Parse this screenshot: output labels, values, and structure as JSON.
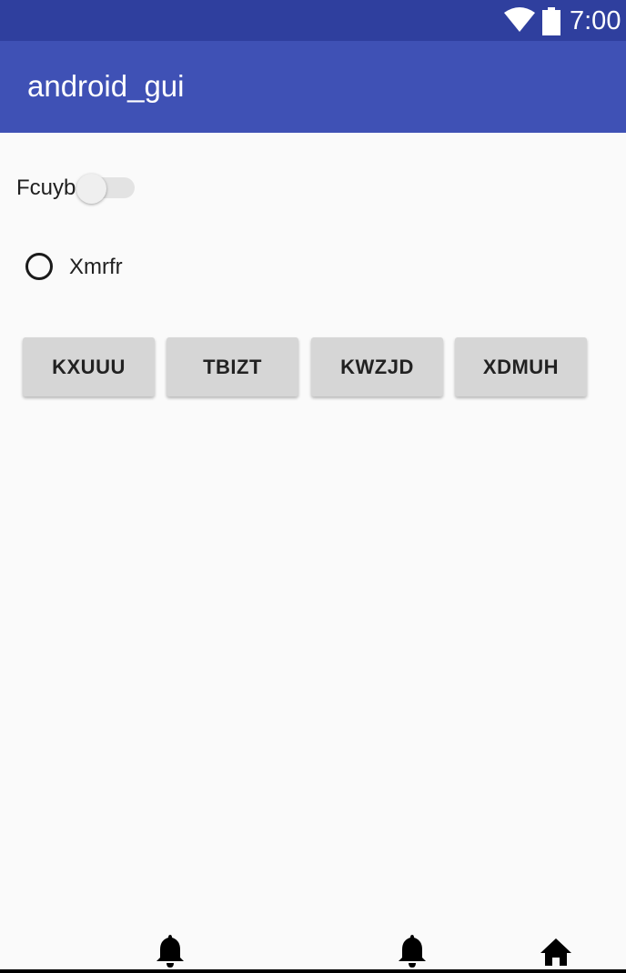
{
  "status_bar": {
    "time": "7:00",
    "icons": [
      "wifi-icon",
      "battery-icon"
    ],
    "background": "#2f3f9e"
  },
  "app_bar": {
    "title": "android_gui",
    "background": "#3f51b5"
  },
  "switch": {
    "label": "Fcuyb",
    "checked": false
  },
  "radio": {
    "label": "Xmrfr",
    "checked": false
  },
  "buttons": [
    {
      "label": "KXUUU"
    },
    {
      "label": "TBIZT"
    },
    {
      "label": "KWZJD"
    },
    {
      "label": "XDMUH"
    }
  ],
  "nav_bar": {
    "icons": [
      "bell-icon",
      "bell-icon",
      "home-icon"
    ]
  }
}
